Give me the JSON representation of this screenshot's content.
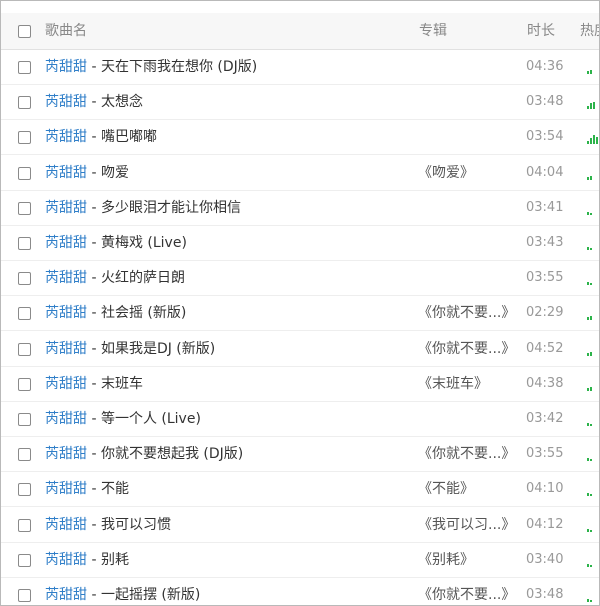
{
  "header": {
    "song_name": "歌曲名",
    "album": "专辑",
    "duration": "时长",
    "heat": "热度"
  },
  "accent_color": "#2f7ec8",
  "heat_color": "#2cb34a",
  "songs": [
    {
      "artist": "芮甜甜",
      "title": " - 天在下雨我在想你 (DJ版)",
      "album": "",
      "duration": "04:36",
      "heat": 0.4
    },
    {
      "artist": "芮甜甜",
      "title": " - 太想念",
      "album": "",
      "duration": "03:48",
      "heat": 0.7
    },
    {
      "artist": "芮甜甜",
      "title": " - 嘴巴嘟嘟",
      "album": "",
      "duration": "03:54",
      "heat": 0.9
    },
    {
      "artist": "芮甜甜",
      "title": " - 吻爱",
      "album": "《吻爱》",
      "duration": "04:04",
      "heat": 0.4
    },
    {
      "artist": "芮甜甜",
      "title": " - 多少眼泪才能让你相信",
      "album": "",
      "duration": "03:41",
      "heat": 0.3
    },
    {
      "artist": "芮甜甜",
      "title": " - 黄梅戏 (Live)",
      "album": "",
      "duration": "03:43",
      "heat": 0.3
    },
    {
      "artist": "芮甜甜",
      "title": " - 火红的萨日朗",
      "album": "",
      "duration": "03:55",
      "heat": 0.3
    },
    {
      "artist": "芮甜甜",
      "title": " - 社会摇 (新版)",
      "album": "《你就不要...》",
      "duration": "02:29",
      "heat": 0.4
    },
    {
      "artist": "芮甜甜",
      "title": " - 如果我是DJ (新版)",
      "album": "《你就不要...》",
      "duration": "04:52",
      "heat": 0.4
    },
    {
      "artist": "芮甜甜",
      "title": " - 末班车",
      "album": "《末班车》",
      "duration": "04:38",
      "heat": 0.4
    },
    {
      "artist": "芮甜甜",
      "title": " - 等一个人 (Live)",
      "album": "",
      "duration": "03:42",
      "heat": 0.3
    },
    {
      "artist": "芮甜甜",
      "title": " - 你就不要想起我 (DJ版)",
      "album": "《你就不要...》",
      "duration": "03:55",
      "heat": 0.3
    },
    {
      "artist": "芮甜甜",
      "title": " - 不能",
      "album": "《不能》",
      "duration": "04:10",
      "heat": 0.3
    },
    {
      "artist": "芮甜甜",
      "title": " - 我可以习惯",
      "album": "《我可以习...》",
      "duration": "04:12",
      "heat": 0.3
    },
    {
      "artist": "芮甜甜",
      "title": " - 别耗",
      "album": "《别耗》",
      "duration": "03:40",
      "heat": 0.3
    },
    {
      "artist": "芮甜甜",
      "title": " - 一起摇摆 (新版)",
      "album": "《你就不要...》",
      "duration": "03:48",
      "heat": 0.3
    }
  ]
}
